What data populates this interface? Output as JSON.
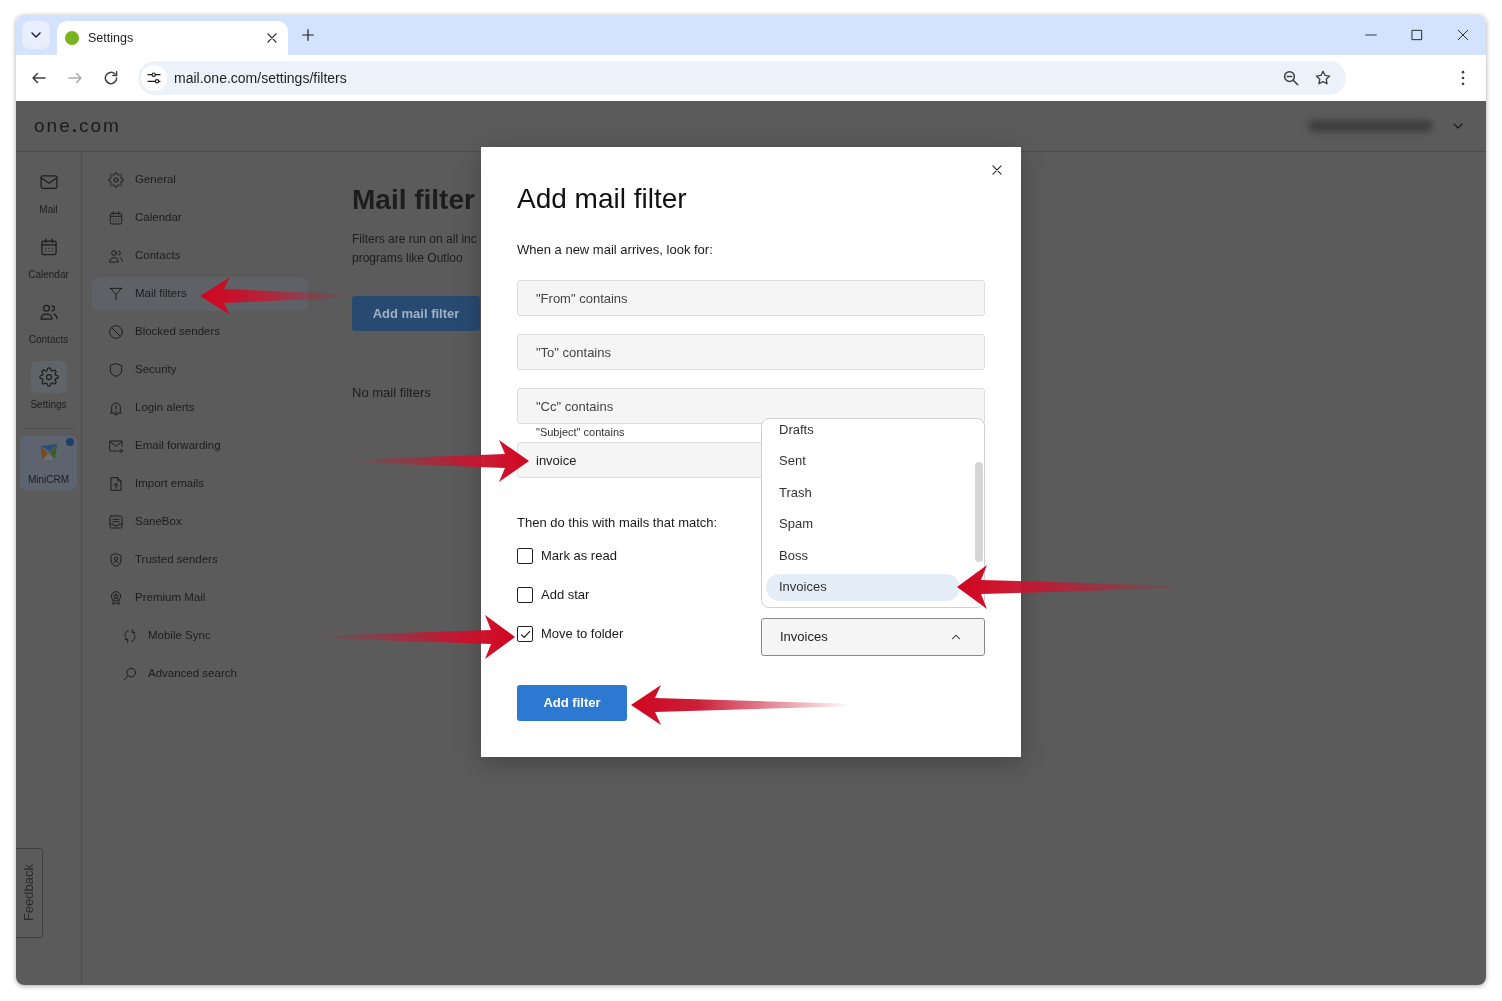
{
  "browser": {
    "tabs": [
      {
        "title": "Settings",
        "selected": true
      }
    ],
    "nav_buttons": [
      {
        "kind": "back",
        "disabled": false
      },
      {
        "kind": "forward",
        "disabled": true
      },
      {
        "kind": "reload",
        "disabled": false
      }
    ],
    "url": "mail.one.com/settings/filters"
  },
  "header": {
    "logo": "one.com"
  },
  "rail": [
    {
      "kind": "mail",
      "label": "Mail",
      "selected": false,
      "notification": false
    },
    {
      "kind": "calendar",
      "label": "Calendar",
      "selected": false,
      "notification": false
    },
    {
      "kind": "contacts",
      "label": "Contacts",
      "selected": false,
      "notification": false
    },
    {
      "kind": "settings",
      "label": "Settings",
      "selected": true,
      "notification": false
    },
    {
      "kind": "app",
      "label": "MiniCRM",
      "selected": false,
      "notification": true
    }
  ],
  "settings_nav": [
    {
      "kind": "general",
      "label": "General",
      "selected": false
    },
    {
      "kind": "calendar",
      "label": "Calendar",
      "selected": false
    },
    {
      "kind": "contacts",
      "label": "Contacts",
      "selected": false
    },
    {
      "kind": "filters",
      "label": "Mail filters",
      "selected": true
    },
    {
      "kind": "blocked",
      "label": "Blocked senders",
      "selected": false
    },
    {
      "kind": "security",
      "label": "Security",
      "selected": false
    },
    {
      "kind": "alerts",
      "label": "Login alerts",
      "selected": false
    },
    {
      "kind": "forwarding",
      "label": "Email forwarding",
      "selected": false
    },
    {
      "kind": "import",
      "label": "Import emails",
      "selected": false
    },
    {
      "kind": "sanebox",
      "label": "SaneBox",
      "selected": false
    },
    {
      "kind": "trusted",
      "label": "Trusted senders",
      "selected": false
    },
    {
      "kind": "premium",
      "label": "Premium Mail",
      "selected": false,
      "children": [
        {
          "kind": "sync",
          "label": "Mobile Sync",
          "selected": false
        },
        {
          "kind": "search",
          "label": "Advanced search",
          "selected": false
        }
      ]
    }
  ],
  "main": {
    "title": "Mail filter",
    "description": [
      "Filters are run on all inc",
      "programs like Outloo"
    ],
    "button": "Add mail filter",
    "empty_text": "No mail filters"
  },
  "dialog": {
    "title": "Add mail filter",
    "intro": "When a new mail arrives, look for:",
    "conditions": [
      {
        "placeholder": "\"From\" contains"
      },
      {
        "placeholder": "\"To\" contains"
      },
      {
        "placeholder": "\"Cc\" contains"
      },
      {
        "label": "\"Subject\" contains",
        "value": "invoice"
      }
    ],
    "actions_intro": "Then do this with mails that match:",
    "actions": [
      {
        "label": "Mark as read",
        "checked": false
      },
      {
        "label": "Add star",
        "checked": false
      },
      {
        "label": "Move to folder",
        "checked": true
      }
    ],
    "folder_select": {
      "value": "Invoices",
      "expanded": true,
      "options": [
        {
          "label": "Drafts",
          "selected": false
        },
        {
          "label": "Sent",
          "selected": false
        },
        {
          "label": "Trash",
          "selected": false
        },
        {
          "label": "Spam",
          "selected": false
        },
        {
          "label": "Boss",
          "selected": false
        },
        {
          "label": "Invoices",
          "selected": true
        }
      ]
    },
    "submit": "Add filter"
  },
  "feedback": "Feedback"
}
